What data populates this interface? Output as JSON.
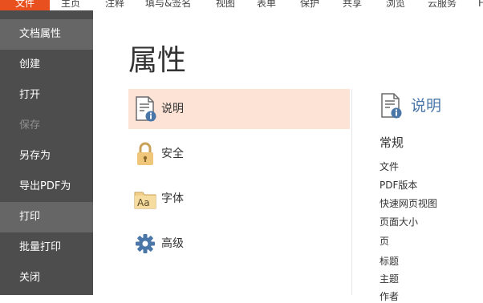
{
  "tabs": [
    {
      "label": "文件",
      "active": true
    },
    {
      "label": "主页"
    },
    {
      "label": "注释"
    },
    {
      "label": "填与&签名"
    },
    {
      "label": "视图"
    },
    {
      "label": "表单"
    },
    {
      "label": "保护"
    },
    {
      "label": "共享"
    },
    {
      "label": "浏览"
    },
    {
      "label": "云服务"
    },
    {
      "label": "F"
    }
  ],
  "sidebar": {
    "items": [
      {
        "label": "文档属性",
        "state": "selected"
      },
      {
        "label": "创建"
      },
      {
        "label": "打开"
      },
      {
        "label": "保存",
        "state": "disabled"
      },
      {
        "label": "另存为"
      },
      {
        "label": "导出PDF为"
      },
      {
        "label": "打印",
        "state": "hover"
      },
      {
        "label": "批量打印"
      },
      {
        "label": "关闭"
      }
    ]
  },
  "page": {
    "title": "属性"
  },
  "categories": [
    {
      "label": "说明",
      "icon": "document-info-icon",
      "selected": true
    },
    {
      "label": "安全",
      "icon": "lock-icon"
    },
    {
      "label": "字体",
      "icon": "font-folder-icon"
    },
    {
      "label": "高级",
      "icon": "gear-icon"
    }
  ],
  "detail": {
    "title": "说明",
    "icon": "document-info-icon",
    "section": "常规",
    "fields": [
      "文件",
      "PDF版本",
      "快速网页视图",
      "页面大小",
      "页",
      "标题",
      "主题",
      "作者"
    ]
  },
  "colors": {
    "accent": "#e8501f",
    "sidebar_bg": "#4d4d4d",
    "selected_bg": "#fde2d6",
    "detail_title": "#4a76a8"
  }
}
